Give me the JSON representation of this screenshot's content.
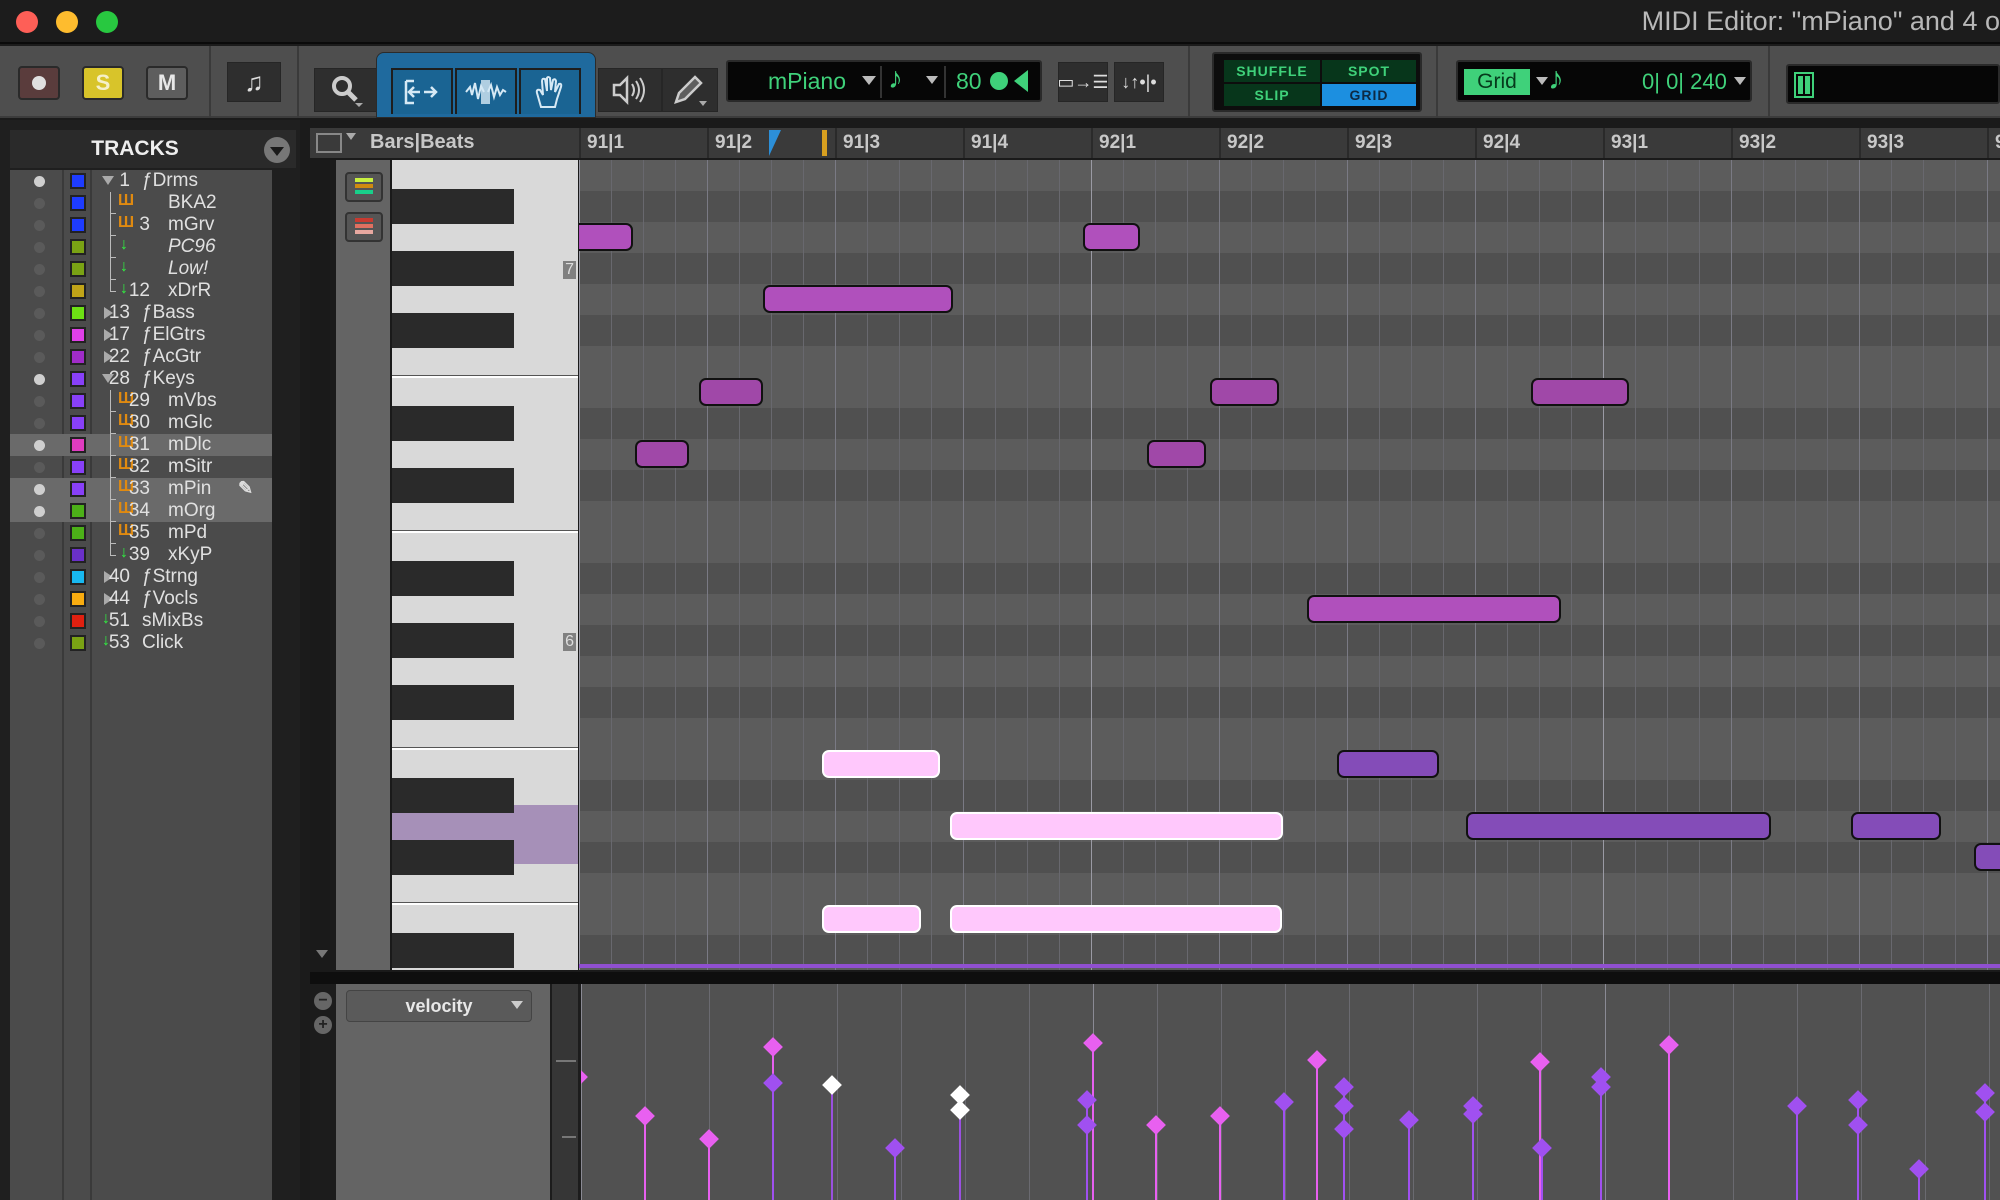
{
  "window": {
    "title": "MIDI Editor: \"mPiano\" and 4 o"
  },
  "toolbar": {
    "record_icon": "record-icon",
    "solo_label": "S",
    "mute_label": "M",
    "notation_icon": "music-note-icon",
    "zoom_icon": "magnifier-icon",
    "tools": [
      "trim-tool",
      "selector-tool",
      "grabber-tool"
    ],
    "audition_icon": "speaker-icon",
    "pencil_icon": "pencil-icon",
    "track_selector": "mPiano",
    "default_note_duration_icon": "eighth-note-icon",
    "default_velocity": "80",
    "mirror_icon": "mirror-midi-icon",
    "edit_modes": {
      "shuffle": "SHUFFLE",
      "spot": "SPOT",
      "slip": "SLIP",
      "grid": "GRID",
      "active": "GRID"
    },
    "grid_label": "Grid",
    "grid_value": "0| 0| 240",
    "keyboard_icon": "keyboard-icon",
    "colors": {
      "lcd_green": "#3fd17a",
      "tool_blue": "#1f6a9e",
      "solo_yellow": "#d8c42a",
      "grid_active": "#1c8fe0"
    }
  },
  "tracks": {
    "header": "TRACKS",
    "items": [
      {
        "num": "1",
        "name": "ƒDrms",
        "color": "#1e3cff",
        "type": "folder-open",
        "dot": true,
        "italic": false,
        "indent": 0
      },
      {
        "num": "",
        "name": "BKA2",
        "color": "#1e3cff",
        "type": "midi",
        "dot": false,
        "italic": false,
        "indent": 1
      },
      {
        "num": "3",
        "name": "mGrv",
        "color": "#1e3cff",
        "type": "midi",
        "dot": false,
        "italic": false,
        "indent": 1
      },
      {
        "num": "",
        "name": "PC96",
        "color": "#7aa214",
        "type": "aux",
        "dot": false,
        "italic": true,
        "indent": 1
      },
      {
        "num": "",
        "name": "Low!",
        "color": "#7aa214",
        "type": "aux",
        "dot": false,
        "italic": true,
        "indent": 1
      },
      {
        "num": "12",
        "name": "xDrR",
        "color": "#c0a418",
        "type": "aux",
        "dot": false,
        "italic": false,
        "indent": 1,
        "last": true
      },
      {
        "num": "13",
        "name": "ƒBass",
        "color": "#6de014",
        "type": "folder-closed",
        "dot": false,
        "italic": false,
        "indent": 0
      },
      {
        "num": "17",
        "name": "ƒElGtrs",
        "color": "#e040e8",
        "type": "folder-closed",
        "dot": false,
        "italic": false,
        "indent": 0
      },
      {
        "num": "22",
        "name": "ƒAcGtr",
        "color": "#a02cc8",
        "type": "folder-closed",
        "dot": false,
        "italic": false,
        "indent": 0
      },
      {
        "num": "28",
        "name": "ƒKeys",
        "color": "#8840f8",
        "type": "folder-open",
        "dot": true,
        "italic": false,
        "indent": 0
      },
      {
        "num": "29",
        "name": "mVbs",
        "color": "#8840f8",
        "type": "midi",
        "dot": false,
        "italic": false,
        "indent": 1
      },
      {
        "num": "30",
        "name": "mGlc",
        "color": "#8840f8",
        "type": "midi",
        "dot": false,
        "italic": false,
        "indent": 1
      },
      {
        "num": "31",
        "name": "mDlc",
        "color": "#e03cc0",
        "type": "midi",
        "dot": true,
        "italic": false,
        "indent": 1,
        "selected": true
      },
      {
        "num": "32",
        "name": "mSitr",
        "color": "#8840f8",
        "type": "midi",
        "dot": false,
        "italic": false,
        "indent": 1
      },
      {
        "num": "33",
        "name": "mPin",
        "color": "#8840f8",
        "type": "midi",
        "dot": true,
        "italic": false,
        "indent": 1,
        "selected": true,
        "pencil": true
      },
      {
        "num": "34",
        "name": "mOrg",
        "color": "#4cb018",
        "type": "midi",
        "dot": true,
        "italic": false,
        "indent": 1,
        "selected": true
      },
      {
        "num": "35",
        "name": "mPd",
        "color": "#4cb018",
        "type": "midi",
        "dot": false,
        "italic": false,
        "indent": 1
      },
      {
        "num": "39",
        "name": "xKyP",
        "color": "#6a30c8",
        "type": "aux",
        "dot": false,
        "italic": false,
        "indent": 1,
        "last": true
      },
      {
        "num": "40",
        "name": "ƒStrng",
        "color": "#18b8f0",
        "type": "folder-closed",
        "dot": false,
        "italic": false,
        "indent": 0
      },
      {
        "num": "44",
        "name": "ƒVocls",
        "color": "#f8ac10",
        "type": "folder-closed",
        "dot": false,
        "italic": false,
        "indent": 0
      },
      {
        "num": "51",
        "name": "sMixBs",
        "color": "#e02010",
        "type": "aux",
        "dot": false,
        "italic": false,
        "indent": 0
      },
      {
        "num": "53",
        "name": "Click",
        "color": "#7aa214",
        "type": "aux",
        "dot": false,
        "italic": false,
        "indent": 0
      }
    ]
  },
  "ruler": {
    "label": "Bars|Beats",
    "ticks": [
      "91|1",
      "91|2",
      "91|3",
      "91|4",
      "92|1",
      "92|2",
      "92|3",
      "92|4",
      "93|1",
      "93|2",
      "93|3",
      "9"
    ]
  },
  "piano": {
    "octave_labels": [
      {
        "label": "7",
        "row": 3
      },
      {
        "label": "6",
        "row": 15
      }
    ],
    "highlighted_row": 21
  },
  "notes": [
    {
      "row": 2,
      "start": -0.1,
      "end": 0.42,
      "color": "#b050bc",
      "sel": false
    },
    {
      "row": 2,
      "start": 3.94,
      "end": 4.38,
      "color": "#b050bc",
      "sel": false
    },
    {
      "row": 4,
      "start": 1.44,
      "end": 2.92,
      "color": "#b050bc",
      "sel": false
    },
    {
      "row": 7,
      "start": 0.94,
      "end": 1.44,
      "color": "#a048a8",
      "sel": false
    },
    {
      "row": 7,
      "start": 4.93,
      "end": 5.47,
      "color": "#a048a8",
      "sel": false
    },
    {
      "row": 7,
      "start": 7.44,
      "end": 8.2,
      "color": "#a048a8",
      "sel": false
    },
    {
      "row": 9,
      "start": 0.44,
      "end": 0.86,
      "color": "#a048a8",
      "sel": false
    },
    {
      "row": 9,
      "start": 4.44,
      "end": 4.9,
      "color": "#a048a8",
      "sel": false
    },
    {
      "row": 14,
      "start": 5.69,
      "end": 7.67,
      "color": "#b050bc",
      "sel": false
    },
    {
      "row": 19,
      "start": 1.9,
      "end": 2.82,
      "color": "#ffc8fc",
      "sel": true
    },
    {
      "row": 19,
      "start": 5.92,
      "end": 6.72,
      "color": "#844cb8",
      "sel": false
    },
    {
      "row": 21,
      "start": 2.9,
      "end": 5.5,
      "color": "#ffc8fc",
      "sel": true
    },
    {
      "row": 21,
      "start": 6.93,
      "end": 9.31,
      "color": "#844cb8",
      "sel": false
    },
    {
      "row": 21,
      "start": 9.94,
      "end": 10.64,
      "color": "#844cb8",
      "sel": false
    },
    {
      "row": 22,
      "start": 10.9,
      "end": 11.6,
      "color": "#844cb8",
      "sel": false
    },
    {
      "row": 24,
      "start": 1.9,
      "end": 2.67,
      "color": "#ffc8fc",
      "sel": true
    },
    {
      "row": 24,
      "start": 2.9,
      "end": 5.49,
      "color": "#ffc8fc",
      "sel": true
    }
  ],
  "velocity_lane": {
    "controller": "velocity",
    "points": [
      {
        "beat": -0.02,
        "v": 84,
        "c": "#e860f0"
      },
      {
        "beat": 0.5,
        "v": 64,
        "c": "#e860f0"
      },
      {
        "beat": 1.0,
        "v": 52,
        "c": "#e860f0"
      },
      {
        "beat": 1.5,
        "v": 100,
        "c": "#e860f0"
      },
      {
        "beat": 1.5,
        "v": 81,
        "c": "#a050f0"
      },
      {
        "beat": 1.96,
        "v": 80,
        "c": "#ffffff"
      },
      {
        "beat": 2.45,
        "v": 47,
        "c": "#a050f0"
      },
      {
        "beat": 2.96,
        "v": 75,
        "c": "#ffffff"
      },
      {
        "beat": 2.96,
        "v": 67,
        "c": "#ffffff"
      },
      {
        "beat": 4.0,
        "v": 102,
        "c": "#e860f0"
      },
      {
        "beat": 3.95,
        "v": 72,
        "c": "#a050f0"
      },
      {
        "beat": 3.95,
        "v": 59,
        "c": "#a050f0"
      },
      {
        "beat": 4.49,
        "v": 59,
        "c": "#e860f0"
      },
      {
        "beat": 4.99,
        "v": 64,
        "c": "#e860f0"
      },
      {
        "beat": 5.49,
        "v": 71,
        "c": "#a050f0"
      },
      {
        "beat": 5.75,
        "v": 93,
        "c": "#e860f0"
      },
      {
        "beat": 5.96,
        "v": 79,
        "c": "#a050f0"
      },
      {
        "beat": 5.96,
        "v": 69,
        "c": "#a050f0"
      },
      {
        "beat": 5.96,
        "v": 57,
        "c": "#a050f0"
      },
      {
        "beat": 6.47,
        "v": 62,
        "c": "#a050f0"
      },
      {
        "beat": 6.97,
        "v": 69,
        "c": "#a050f0"
      },
      {
        "beat": 6.97,
        "v": 65,
        "c": "#a050f0"
      },
      {
        "beat": 7.49,
        "v": 92,
        "c": "#e860f0"
      },
      {
        "beat": 7.51,
        "v": 47,
        "c": "#a050f0"
      },
      {
        "beat": 7.97,
        "v": 84,
        "c": "#a050f0"
      },
      {
        "beat": 7.97,
        "v": 79,
        "c": "#a050f0"
      },
      {
        "beat": 8.5,
        "v": 101,
        "c": "#e860f0"
      },
      {
        "beat": 9.5,
        "v": 69,
        "c": "#a050f0"
      },
      {
        "beat": 9.98,
        "v": 72,
        "c": "#a050f0"
      },
      {
        "beat": 9.98,
        "v": 59,
        "c": "#a050f0"
      },
      {
        "beat": 10.45,
        "v": 36,
        "c": "#a050f0"
      },
      {
        "beat": 10.97,
        "v": 76,
        "c": "#a050f0"
      },
      {
        "beat": 10.97,
        "v": 66,
        "c": "#a050f0"
      }
    ]
  }
}
